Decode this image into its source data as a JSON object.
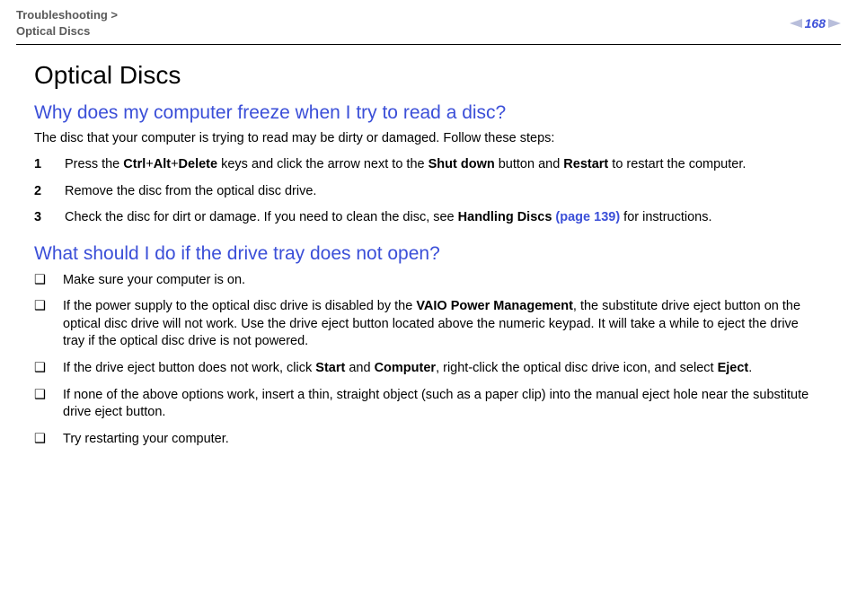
{
  "header": {
    "crumb_line1": "Troubleshooting >",
    "crumb_line2": "Optical Discs",
    "page_number": "168"
  },
  "h1": "Optical Discs",
  "section1": {
    "heading": "Why does my computer freeze when I try to read a disc?",
    "lead": "The disc that your computer is trying to read may be dirty or damaged. Follow these steps:",
    "steps": [
      {
        "n": "1",
        "pre": "Press the ",
        "b1": "Ctrl",
        "plus1": "+",
        "b2": "Alt",
        "plus2": "+",
        "b3": "Delete",
        "mid1": " keys and click the arrow next to the ",
        "b4": "Shut down",
        "mid2": " button and ",
        "b5": "Restart",
        "tail": " to restart the computer."
      },
      {
        "n": "2",
        "text": "Remove the disc from the optical disc drive."
      },
      {
        "n": "3",
        "pre": "Check the disc for dirt or damage. If you need to clean the disc, see ",
        "b1": "Handling Discs",
        "link": " (page 139)",
        "tail": " for instructions."
      }
    ]
  },
  "section2": {
    "heading": "What should I do if the drive tray does not open?",
    "bullets": [
      {
        "text": "Make sure your computer is on."
      },
      {
        "pre": "If the power supply to the optical disc drive is disabled by the ",
        "b1": "VAIO Power Management",
        "tail": ", the substitute drive eject button on the optical disc drive will not work. Use the drive eject button located above the numeric keypad. It will take a while to eject the drive tray if the optical disc drive is not powered."
      },
      {
        "pre": "If the drive eject button does not work, click ",
        "b1": "Start",
        "mid1": " and ",
        "b2": "Computer",
        "mid2": ", right-click the optical disc drive icon, and select ",
        "b3": "Eject",
        "tail": "."
      },
      {
        "text": "If none of the above options work, insert a thin, straight object (such as a paper clip) into the manual eject hole near the substitute drive eject button."
      },
      {
        "text": "Try restarting your computer."
      }
    ]
  },
  "bullet_glyph": "❑"
}
